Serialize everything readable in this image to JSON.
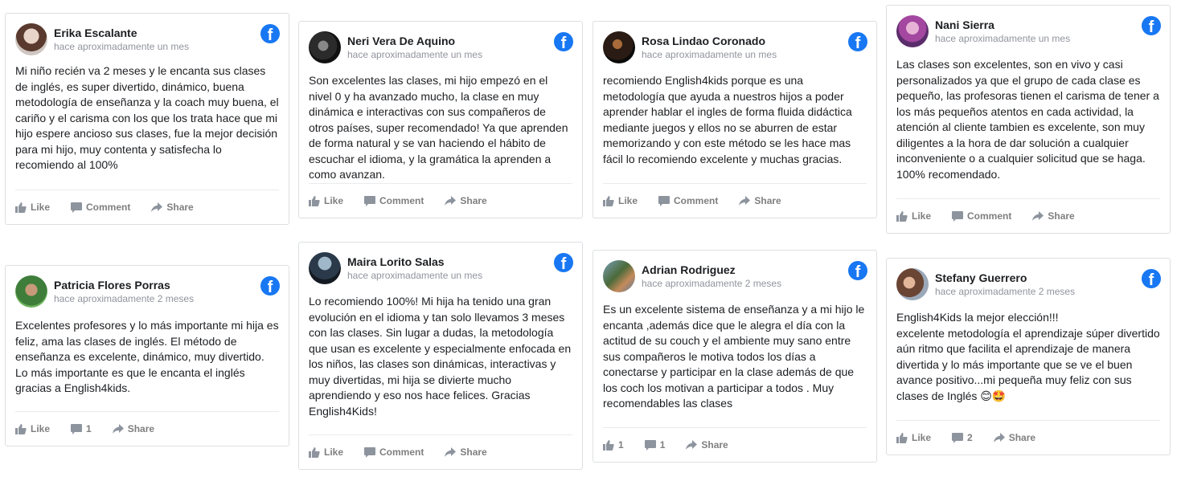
{
  "colors": {
    "facebook_blue": "#1877f2",
    "border": "#dddfe2",
    "muted": "#90949c"
  },
  "icons": {
    "brand": "facebook-icon",
    "like": "thumbs-up-icon",
    "comment": "comment-icon",
    "share": "share-arrow-icon"
  },
  "reviews": [
    {
      "name": "Erika Escalante",
      "time": "hace aproximadamente un mes",
      "text": "Mi niño recién va 2 meses y le encanta sus clases de inglés, es super divertido, dinámico, buena metodología de enseñanza y la coach muy buena, el cariño y el carisma con los que los trata hace que mi hijo espere ancioso sus clases, fue la mejor decisión para mi hijo, muy contenta y satisfecha lo recomiendo al 100%",
      "like": "Like",
      "comment": "Comment",
      "share": "Share"
    },
    {
      "name": "Neri Vera De Aquino",
      "time": "hace aproximadamente un mes",
      "text": "Son excelentes las clases, mi hijo empezó en el nivel 0 y ha avanzado mucho, la clase en muy dinámica e interactivas con sus compañeros de otros países, super recomendado! Ya que aprenden de forma natural y se van haciendo el hábito de escuchar el idioma, y la gramática la aprenden a como avanzan.",
      "like": "Like",
      "comment": "Comment",
      "share": "Share"
    },
    {
      "name": "Rosa Lindao Coronado",
      "time": "hace aproximadamente un mes",
      "text": "recomiendo English4kids porque es una metodología que ayuda a nuestros hijos a poder aprender hablar el ingles de forma fluida didáctica mediante juegos y ellos no se aburren de estar memorizando y con este método se les hace mas fácil lo recomiendo excelente y muchas gracias.",
      "like": "Like",
      "comment": "Comment",
      "share": "Share"
    },
    {
      "name": "Nani Sierra",
      "time": "hace aproximadamente un mes",
      "text": "Las clases son excelentes, son en vivo y casi personalizados ya que el grupo de cada clase es pequeño, las profesoras tienen el carisma de tener a los más pequeños atentos en cada actividad, la atención al cliente tambien es excelente, son muy diligentes a la hora de dar solución a cualquier inconveniente o a cualquier solicitud que se haga. 100% recomendado.",
      "like": "Like",
      "comment": "Comment",
      "share": "Share"
    },
    {
      "name": "Patricia Flores Porras",
      "time": "hace aproximadamente 2 meses",
      "text": "Excelentes profesores y lo más importante mi hija es feliz, ama las clases de inglés. El método de enseñanza es excelente, dinámico, muy divertido. Lo más importante es que le encanta el inglés gracias a English4kids.",
      "like": "Like",
      "comment": "1",
      "share": "Share"
    },
    {
      "name": "Maira Lorito Salas",
      "time": "hace aproximadamente un mes",
      "text": "Lo recomiendo 100%! Mi hija ha tenido una gran evolución en el idioma y tan solo llevamos 3 meses con las clases. Sin lugar a dudas, la metodología que usan es excelente y especialmente enfocada en los niños, las clases son dinámicas, interactivas y muy divertidas, mi hija se divierte mucho aprendiendo y eso nos hace felices. Gracias English4Kids!",
      "like": "Like",
      "comment": "Comment",
      "share": "Share"
    },
    {
      "name": "Adrian Rodriguez",
      "time": "hace aproximadamente 2 meses",
      "text": "Es un excelente sistema de enseñanza y a mi hijo le encanta ,además dice que le alegra el día con la actitud de su couch y el ambiente muy sano entre sus compañeros le motiva todos los días a conectarse y participar en la clase además de que los coch los motivan a participar a todos . Muy recomendables las clases",
      "like": "1",
      "comment": "1",
      "share": "Share"
    },
    {
      "name": "Stefany Guerrero",
      "time": "hace aproximadamente 2 meses",
      "text": "English4Kids la mejor elección!!!\nexcelente metodología el aprendizaje súper divertido aún ritmo que facilita el aprendizaje de manera divertida y lo más importante que se ve el buen avance positivo...mi pequeña muy feliz con sus clases de Inglés 😊🤩",
      "like": "Like",
      "comment": "2",
      "share": "Share"
    }
  ]
}
